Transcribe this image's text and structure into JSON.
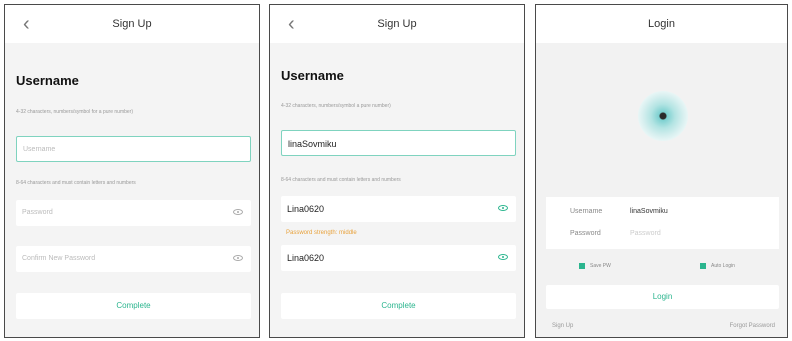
{
  "signup1": {
    "title": "Sign Up",
    "heading": "Username",
    "username_hint": "4-32 characters, numbers/symbol for a pure number)",
    "username_placeholder": "Username",
    "password_hint": "8-64 characters and must contain letters and numbers",
    "password_placeholder": "Password",
    "confirm_placeholder": "Confirm New Password",
    "complete_label": "Complete"
  },
  "signup2": {
    "title": "Sign Up",
    "heading": "Username",
    "username_hint": "4-32 characters, numbers/symbol a pure number)",
    "username_value": "linaSovmiku",
    "password_hint": "8-64 characters and must contain letters and numbers",
    "password_value": "Lina0620",
    "strength_text": "Password strength: middle",
    "confirm_value": "Lina0620",
    "complete_label": "Complete"
  },
  "login": {
    "title": "Login",
    "username_label": "Username",
    "username_value": "linaSovmiku",
    "password_label": "Password",
    "password_placeholder": "Password",
    "save_pw_label": "Save PW",
    "auto_login_label": "Auto Login",
    "login_label": "Login",
    "signup_link": "Sign Up",
    "forgot_link": "Forgot Password"
  },
  "colors": {
    "accent": "#2bb58e",
    "warning": "#e8a23c",
    "field_focus": "#7fd3bf"
  },
  "icons": {
    "back": "chevron-left-icon",
    "eye": "eye-icon"
  }
}
